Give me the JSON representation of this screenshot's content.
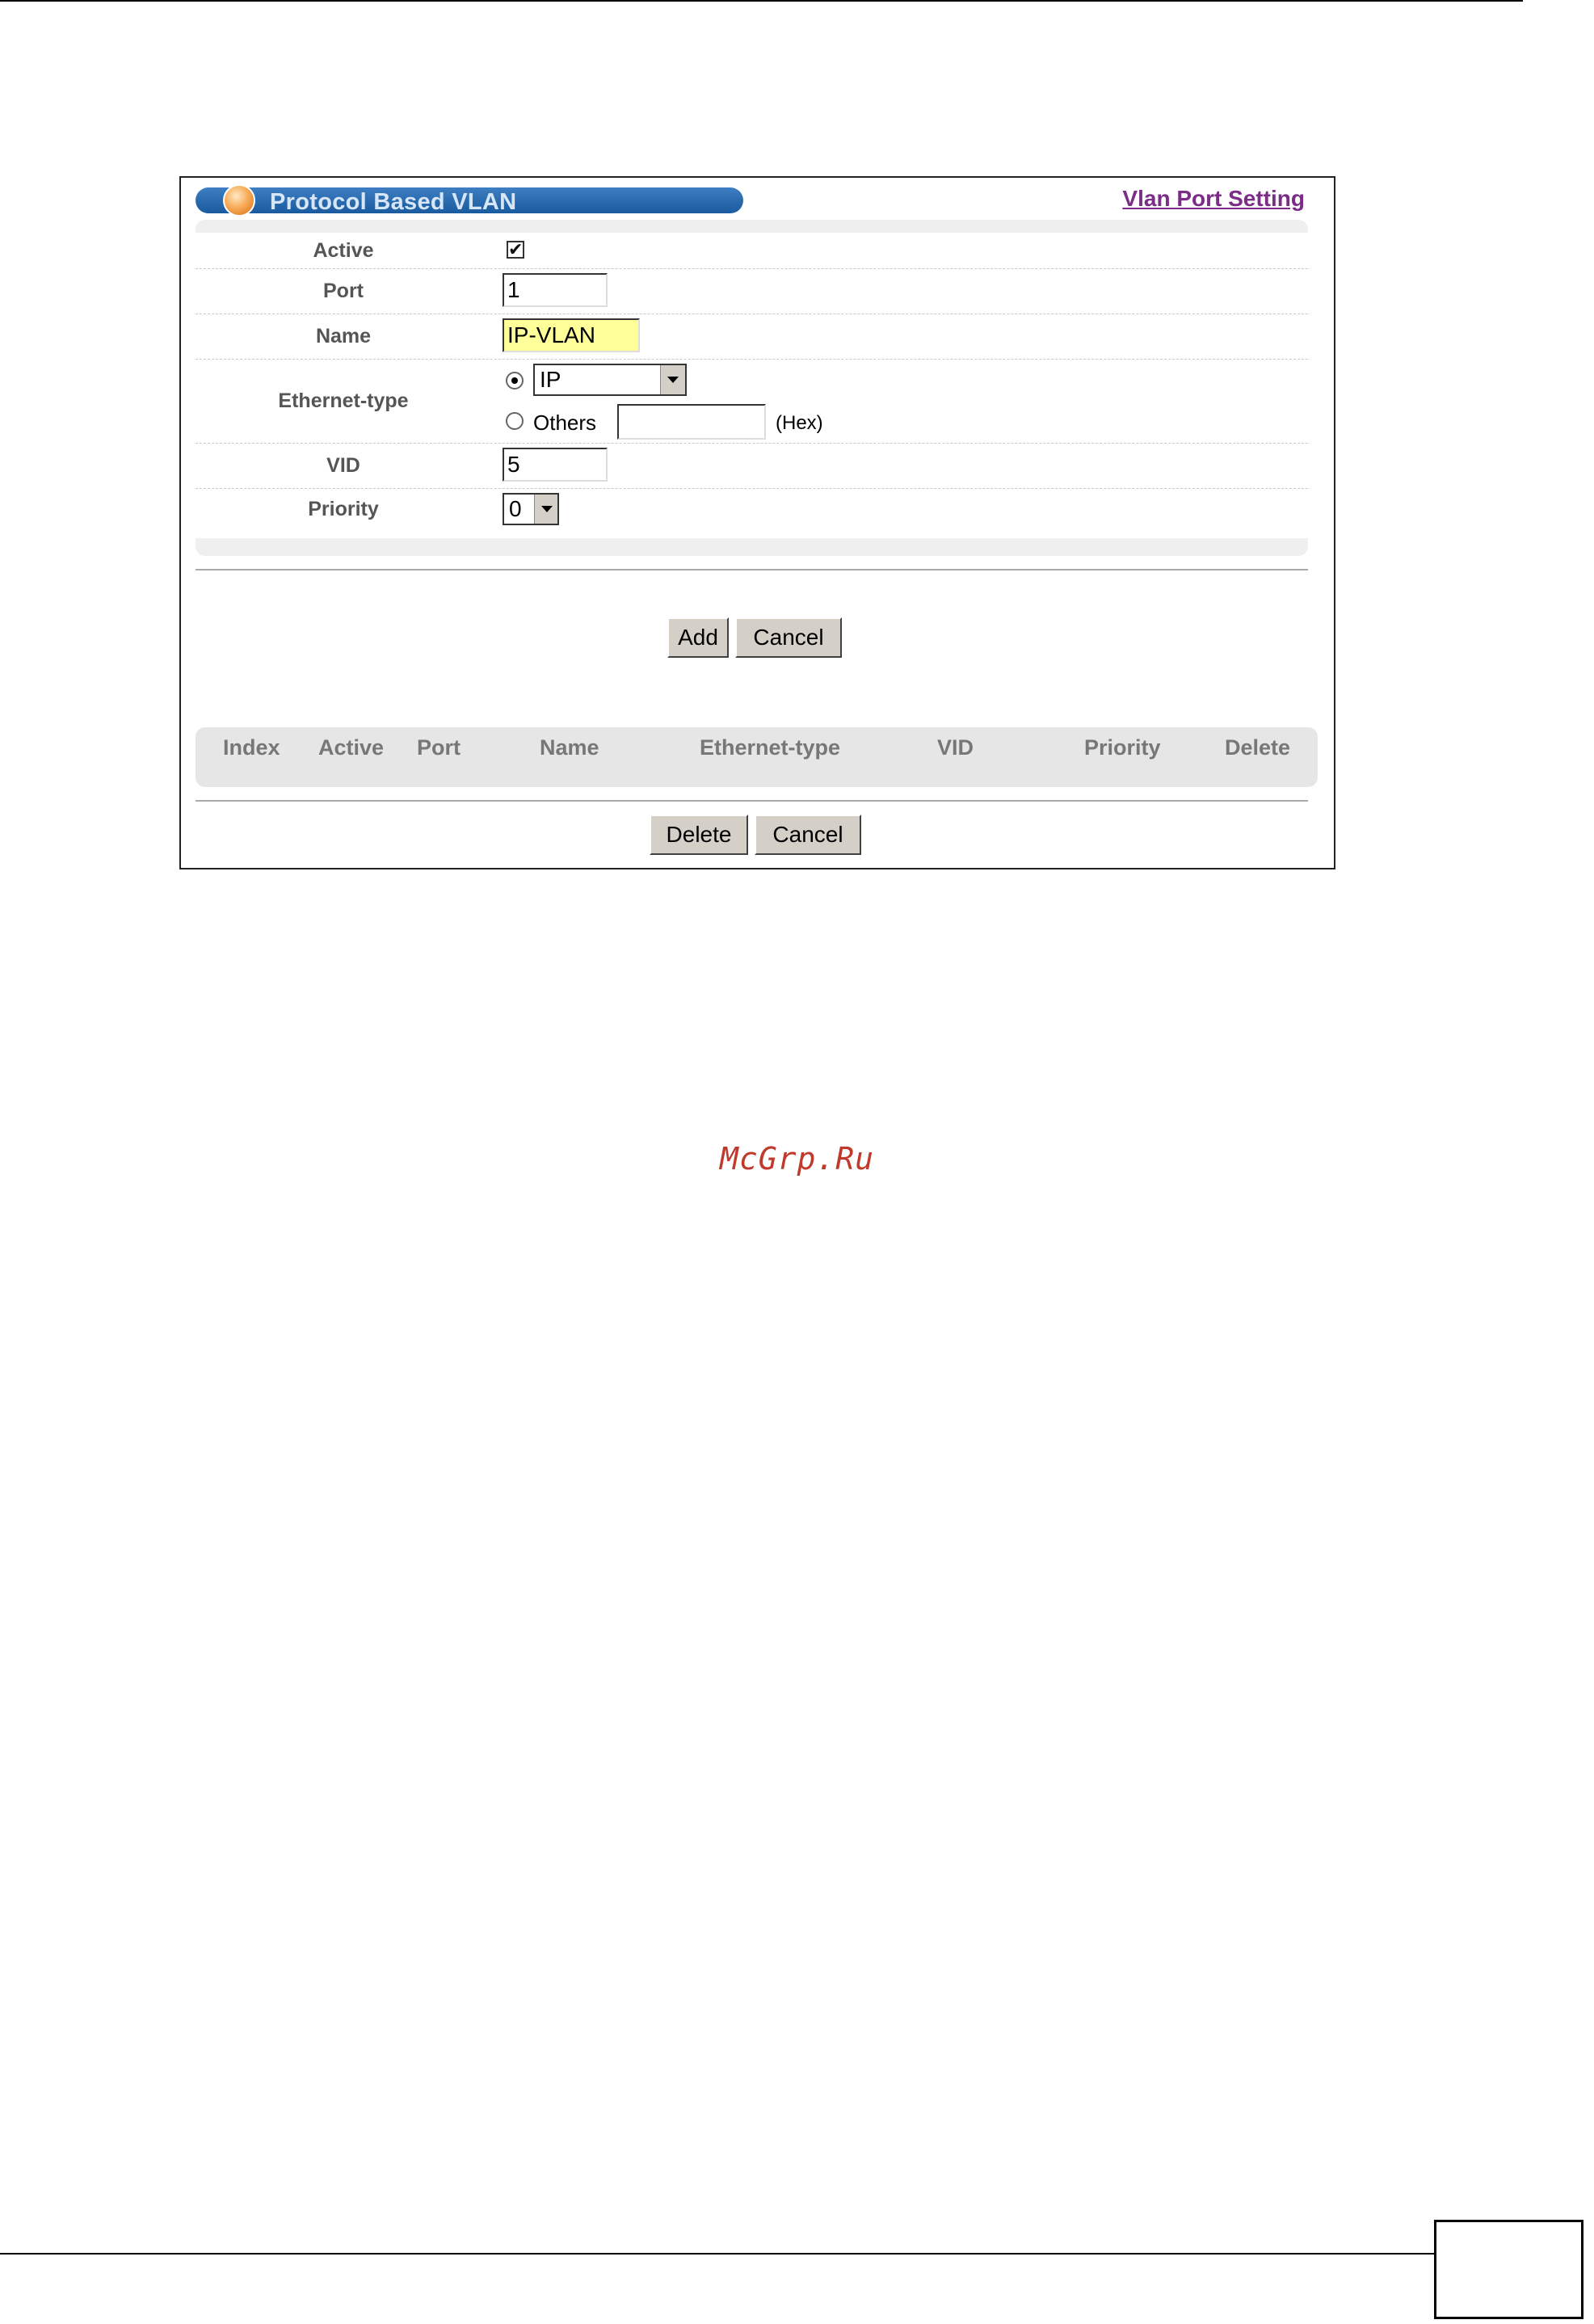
{
  "header": {
    "title": "Protocol Based VLAN",
    "link_label": "Vlan Port Setting"
  },
  "form": {
    "active_label": "Active",
    "active_checked": true,
    "active_mark": "✔",
    "port_label": "Port",
    "port_value": "1",
    "name_label": "Name",
    "name_value": "IP-VLAN",
    "ethertype_label": "Ethernet-type",
    "ethertype_selected": "IP",
    "ethertype_others_label": "Others",
    "ethertype_others_value": "",
    "hex_label": "(Hex)",
    "vid_label": "VID",
    "vid_value": "5",
    "priority_label": "Priority",
    "priority_selected": "0"
  },
  "buttons": {
    "add": "Add",
    "cancel": "Cancel",
    "delete": "Delete",
    "cancel2": "Cancel"
  },
  "table": {
    "columns": [
      "Index",
      "Active",
      "Port",
      "Name",
      "Ethernet-type",
      "VID",
      "Priority",
      "Delete"
    ]
  },
  "watermark": "McGrp.Ru"
}
